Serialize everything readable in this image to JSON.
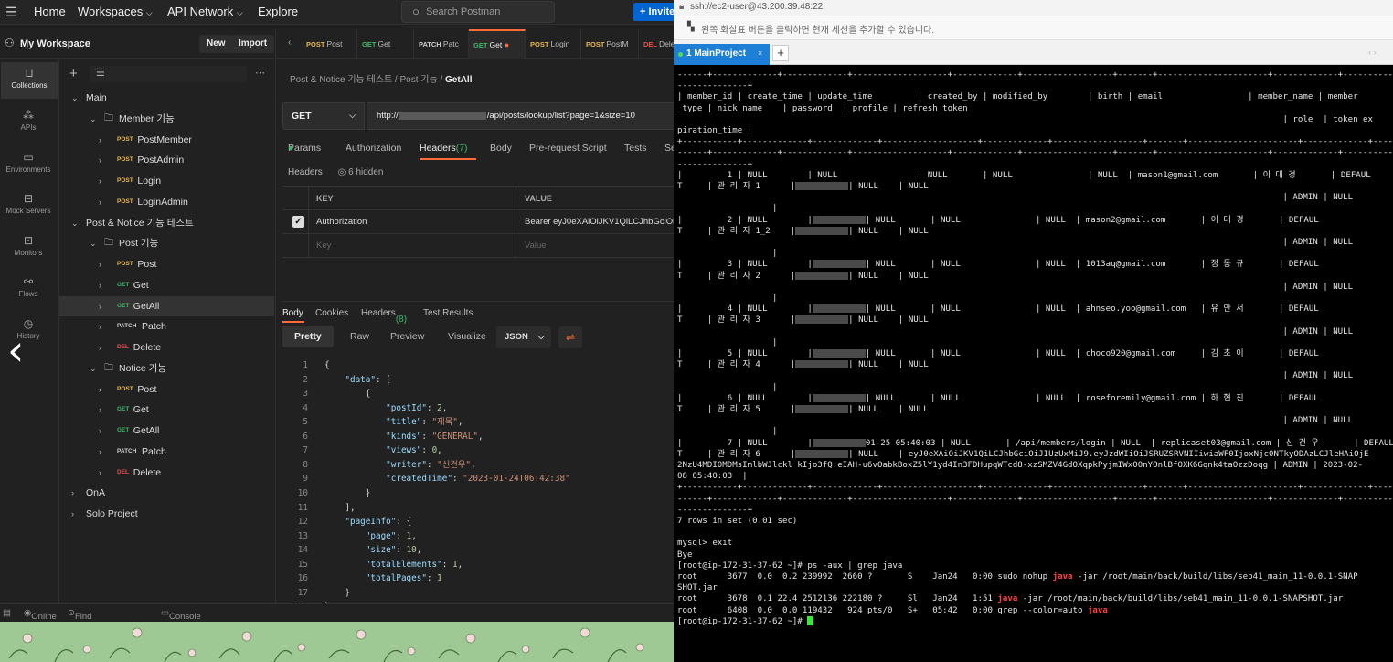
{
  "postman": {
    "topbar": {
      "home": "Home",
      "workspaces": "Workspaces",
      "api_network": "API Network",
      "explore": "Explore",
      "search_placeholder": "Search Postman",
      "invite": "Invite"
    },
    "workspace": {
      "title": "My Workspace",
      "new_label": "New",
      "import_label": "Import"
    },
    "leftnav": [
      "Collections",
      "APIs",
      "Environments",
      "Mock Servers",
      "Monitors",
      "Flows",
      "History"
    ],
    "tree": [
      {
        "depth": 0,
        "kind": "folder",
        "expanded": true,
        "label": "Main"
      },
      {
        "depth": 1,
        "kind": "folder",
        "expanded": true,
        "label": "Member 기능"
      },
      {
        "depth": 2,
        "kind": "request",
        "method": "POST",
        "label": "PostMember"
      },
      {
        "depth": 2,
        "kind": "request",
        "method": "POST",
        "label": "PostAdmin"
      },
      {
        "depth": 2,
        "kind": "request",
        "method": "POST",
        "label": "Login"
      },
      {
        "depth": 2,
        "kind": "request",
        "method": "POST",
        "label": "LoginAdmin"
      },
      {
        "depth": 0,
        "kind": "folder",
        "expanded": true,
        "label": "Post & Notice 기능 테스트"
      },
      {
        "depth": 1,
        "kind": "folder",
        "expanded": true,
        "label": "Post 기능"
      },
      {
        "depth": 2,
        "kind": "request",
        "method": "POST",
        "label": "Post"
      },
      {
        "depth": 2,
        "kind": "request",
        "method": "GET",
        "label": "Get"
      },
      {
        "depth": 2,
        "kind": "request",
        "method": "GET",
        "label": "GetAll",
        "selected": true
      },
      {
        "depth": 2,
        "kind": "request",
        "method": "PATCH",
        "label": "Patch"
      },
      {
        "depth": 2,
        "kind": "request",
        "method": "DEL",
        "label": "Delete"
      },
      {
        "depth": 1,
        "kind": "folder",
        "expanded": true,
        "label": "Notice 기능"
      },
      {
        "depth": 2,
        "kind": "request",
        "method": "POST",
        "label": "Post"
      },
      {
        "depth": 2,
        "kind": "request",
        "method": "GET",
        "label": "Get"
      },
      {
        "depth": 2,
        "kind": "request",
        "method": "GET",
        "label": "GetAll"
      },
      {
        "depth": 2,
        "kind": "request",
        "method": "PATCH",
        "label": "Patch"
      },
      {
        "depth": 2,
        "kind": "request",
        "method": "DEL",
        "label": "Delete"
      },
      {
        "depth": 0,
        "kind": "folder",
        "expanded": false,
        "label": "QnA"
      },
      {
        "depth": 0,
        "kind": "folder",
        "expanded": false,
        "label": "Solo Project"
      }
    ],
    "tabs": [
      {
        "method": "POST",
        "label": "Post"
      },
      {
        "method": "GET",
        "label": "Get"
      },
      {
        "method": "PATCH",
        "label": "Patc"
      },
      {
        "method": "GET",
        "label": "Get",
        "active": true
      },
      {
        "method": "POST",
        "label": "Login"
      },
      {
        "method": "POST",
        "label": "PostM"
      },
      {
        "method": "DEL",
        "label": "Dele"
      }
    ],
    "breadcrumb": {
      "part1": "Post & Notice 기능 테스트",
      "sep": "/",
      "part2": "Post 기능",
      "current": "GetAll"
    },
    "request": {
      "method": "GET",
      "url_prefix": "http://",
      "url_suffix": "/api/posts/lookup/list?page=1&size=10"
    },
    "request_tabs": {
      "params": "Params",
      "authorization": "Authorization",
      "headers": "Headers (7)",
      "body": "Body",
      "prerequest": "Pre-request Script",
      "tests": "Tests",
      "settings": "Se"
    },
    "headers_section": {
      "label": "Headers",
      "hidden": "6 hidden"
    },
    "kv": {
      "key_header": "KEY",
      "value_header": "VALUE",
      "row_key": "Authorization",
      "row_value": "Bearer eyJ0eXAiOiJKV1QiLCJhbGciOi",
      "key_placeholder": "Key",
      "value_placeholder": "Value"
    },
    "response_tabs": {
      "body": "Body",
      "cookies": "Cookies",
      "headers": "Headers (8)",
      "tests": "Test Results"
    },
    "format": {
      "pretty": "Pretty",
      "raw": "Raw",
      "preview": "Preview",
      "visualize": "Visualize",
      "type": "JSON"
    },
    "code_lines": [
      "{",
      "    \"data\": [",
      "        {",
      "            \"postId\": 2,",
      "            \"title\": \"제목\",",
      "            \"kinds\": \"GENERAL\",",
      "            \"views\": 0,",
      "            \"writer\": \"신건우\",",
      "            \"createdTime\": \"2023-01-24T06:42:38\"",
      "        }",
      "    ],",
      "    \"pageInfo\": {",
      "        \"page\": 1,",
      "        \"size\": 10,",
      "        \"totalElements\": 1,",
      "        \"totalPages\": 1",
      "    }",
      "}"
    ],
    "statusbar": {
      "online": "Online",
      "find": "Find and Replace",
      "console": "Console"
    }
  },
  "terminal": {
    "title": "ssh://ec2-user@43.200.39.48:22",
    "hint": "왼쪽 화살표 버튼을 클릭하면 현재 세션을 추가할 수 있습니다.",
    "tab_label": "1 MainProject",
    "lines": [
      "------+-------------+-------------+-------------------+-------------+------------------+-------+----------------------+-------------+-------------",
      "--------------+",
      "| member_id | create_time | update_time         | created_by | modified_by        | birth | email                 | member_name | member",
      "_type | nick_name    | password  | profile | refresh_token",
      "                                                                                                                         | role  | token_ex",
      "piration_time |",
      "+-----------+-------------+-------------+-------------------+-------------+------------------+-------+----------------------+-------------+-------------",
      "------+-------------+-------------+-------------------+-------------+------------------+-------+----------------------+-------------+-------------",
      "--------------+",
      "|         1 | NULL        | NULL                | NULL       | NULL               | NULL  | mason1@gmail.com       | 이 대 경       | DEFAUL",
      "T     | 관 리 자 1      |{BLUR}| NULL    | NULL",
      "                                                                                                                         | ADMIN | NULL",
      "                   |",
      "|         2 | NULL        |{BLUR}| NULL       | NULL               | NULL  | mason2@gmail.com       | 이 대 경       | DEFAUL",
      "T     | 관 리 자 1_2    |{BLUR}| NULL    | NULL",
      "                                                                                                                         | ADMIN | NULL",
      "                   |",
      "|         3 | NULL        |{BLUR}| NULL       | NULL               | NULL  | 1013aq@gmail.com       | 정 동 규       | DEFAUL",
      "T     | 관 리 자 2      |{BLUR}| NULL    | NULL",
      "                                                                                                                         | ADMIN | NULL",
      "                   |",
      "|         4 | NULL        |{BLUR}| NULL       | NULL               | NULL  | ahnseo.yoo@gmail.com   | 유 안 서       | DEFAUL",
      "T     | 관 리 자 3      |{BLUR}| NULL    | NULL",
      "                                                                                                                         | ADMIN | NULL",
      "                   |",
      "|         5 | NULL        |{BLUR}| NULL       | NULL               | NULL  | choco920@gmail.com     | 김 초 이       | DEFAUL",
      "T     | 관 리 자 4      |{BLUR}| NULL    | NULL",
      "                                                                                                                         | ADMIN | NULL",
      "                   |",
      "|         6 | NULL        |{BLUR}| NULL       | NULL               | NULL  | roseforemily@gmail.com | 하 현 진       | DEFAUL",
      "T     | 관 리 자 5      |{BLUR}| NULL    | NULL",
      "                                                                                                                         | ADMIN | NULL",
      "                   |",
      "|         7 | NULL        |{BLUR}01-25 05:40:03 | NULL       | /api/members/login | NULL  | replicaset03@gmail.com | 신 건 우       | DEFAUL",
      "T     | 관 리 자 6      |{BLUR}| NULL    | eyJ0eXAiOiJKV1QiLCJhbGciOiJIUzUxMiJ9.eyJzdWIiOiJSRUZSRVNIIiwiaWF0IjoxNjc0NTkyODAzLCJleHAiOjE",
      "2NzU4MDI0MDMsImlbWJlckl kIjo3fQ.eIAH-u6vOabkBoxZ5lY1yd4In3FDHupqWTcd8-xzSMZV4GdOXqpkPyjmIWx00nYOnlBfOXK6Gqnk4taOzzDoqg | ADMIN | 2023-02-",
      "08 05:40:03  |",
      "+-----------+-------------+-------------+-------------------+-------------+------------------+-------+----------------------+-------------+-------------",
      "------+-------------+-------------+-------------------+-------------+------------------+-------+----------------------+-------------+-------------",
      "--------------+",
      "7 rows in set (0.01 sec)",
      "",
      "mysql> exit",
      "Bye",
      "[root@ip-172-31-37-62 ~]# ps -aux | grep java",
      "root      3677  0.0  0.2 239992  2660 ?       S    Jan24   0:00 sudo nohup {JAVA} -jar /root/main/back/build/libs/seb41_main_11-0.0.1-SNAP",
      "SHOT.jar",
      "root      3678  0.1 22.4 2512136 222180 ?     Sl   Jan24   1:51 {JAVA} -jar /root/main/back/build/libs/seb41_main_11-0.0.1-SNAPSHOT.jar",
      "root      6408  0.0  0.0 119432   924 pts/0   S+   05:42   0:00 grep --color=auto {JAVA}",
      "[root@ip-172-31-37-62 ~]# {CURSOR}"
    ],
    "highlight_word": "java"
  },
  "colors": {
    "accent": "#ff6c37",
    "post": "#e9b74c",
    "get": "#3db86a",
    "delete": "#e05252",
    "terminal_tab": "#1e7fd6"
  }
}
